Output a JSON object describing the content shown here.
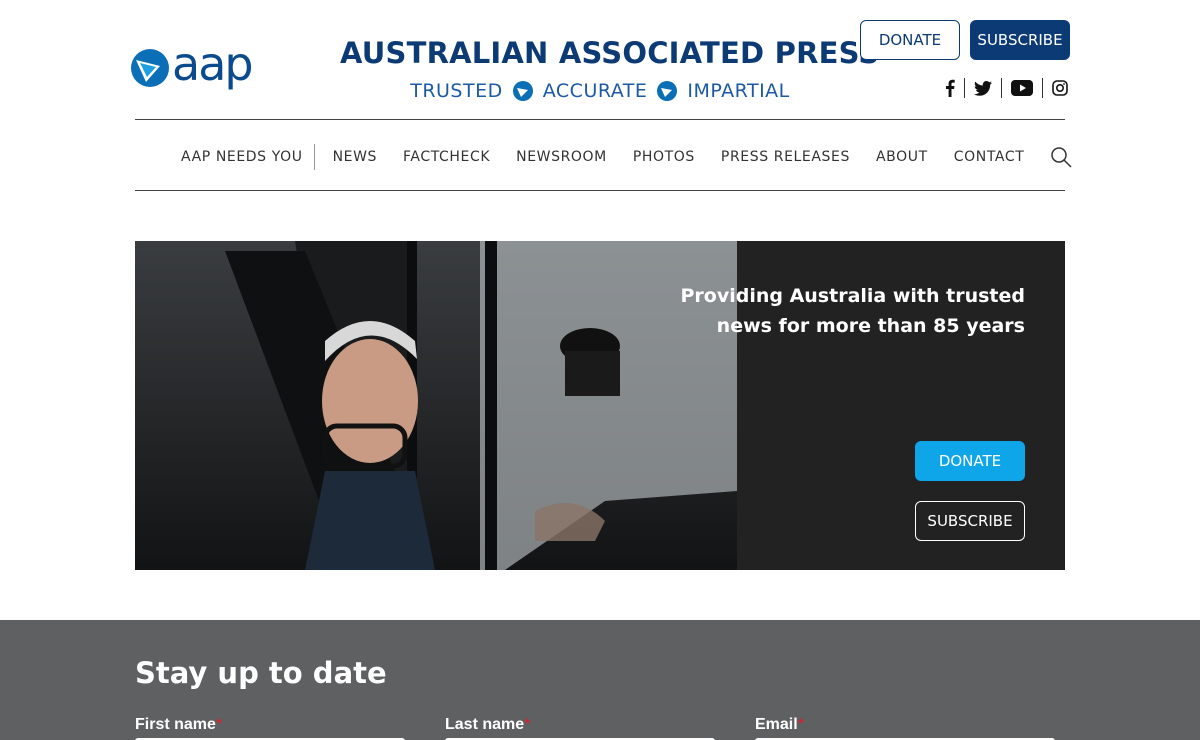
{
  "brand": {
    "logo_text": "aap",
    "title": "AUSTRALIAN ASSOCIATED PRESS",
    "tagline": [
      "TRUSTED",
      "ACCURATE",
      "IMPARTIAL"
    ],
    "primary_color": "#0b3a74",
    "accent_color": "#0ea5e9"
  },
  "header_buttons": {
    "donate": "DONATE",
    "subscribe": "SUBSCRIBE"
  },
  "social": [
    "facebook-icon",
    "twitter-icon",
    "youtube-icon",
    "instagram-icon"
  ],
  "nav": {
    "items": [
      "AAP NEEDS YOU",
      "NEWS",
      "FACTCHECK",
      "NEWSROOM",
      "PHOTOS",
      "PRESS RELEASES",
      "ABOUT",
      "CONTACT"
    ],
    "search_icon": "search-icon"
  },
  "hero": {
    "headline": "Providing Australia with trusted news for more than 85 years",
    "donate": "DONATE",
    "subscribe": "SUBSCRIBE"
  },
  "newsletter": {
    "title": "Stay up to date",
    "fields": [
      {
        "label": "First name",
        "required": "*"
      },
      {
        "label": "Last name",
        "required": "*"
      },
      {
        "label": "Email",
        "required": "*"
      }
    ]
  }
}
